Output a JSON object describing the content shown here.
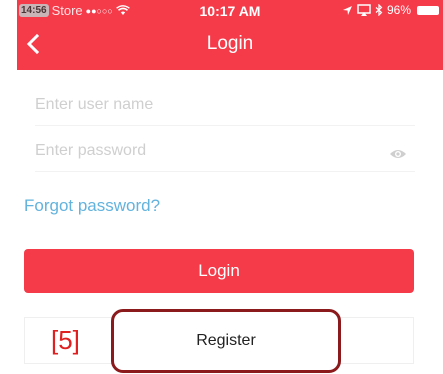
{
  "status_bar": {
    "time_badge": "14:56",
    "carrier": "Store",
    "signal": "●●○○○",
    "time": "10:17 AM",
    "battery": "96%"
  },
  "nav": {
    "title": "Login",
    "back_icon": "chevron-left-icon"
  },
  "form": {
    "username_placeholder": "Enter user name",
    "password_placeholder": "Enter password",
    "eye_icon": "eye-icon",
    "forgot_label": "Forgot password?",
    "login_label": "Login",
    "register_label": "Register"
  },
  "annotation": {
    "label": "[5]"
  },
  "colors": {
    "accent": "#f53b4a",
    "link": "#62b3de",
    "annotation_border": "#8b1a1c",
    "annotation_text": "#e02020"
  }
}
